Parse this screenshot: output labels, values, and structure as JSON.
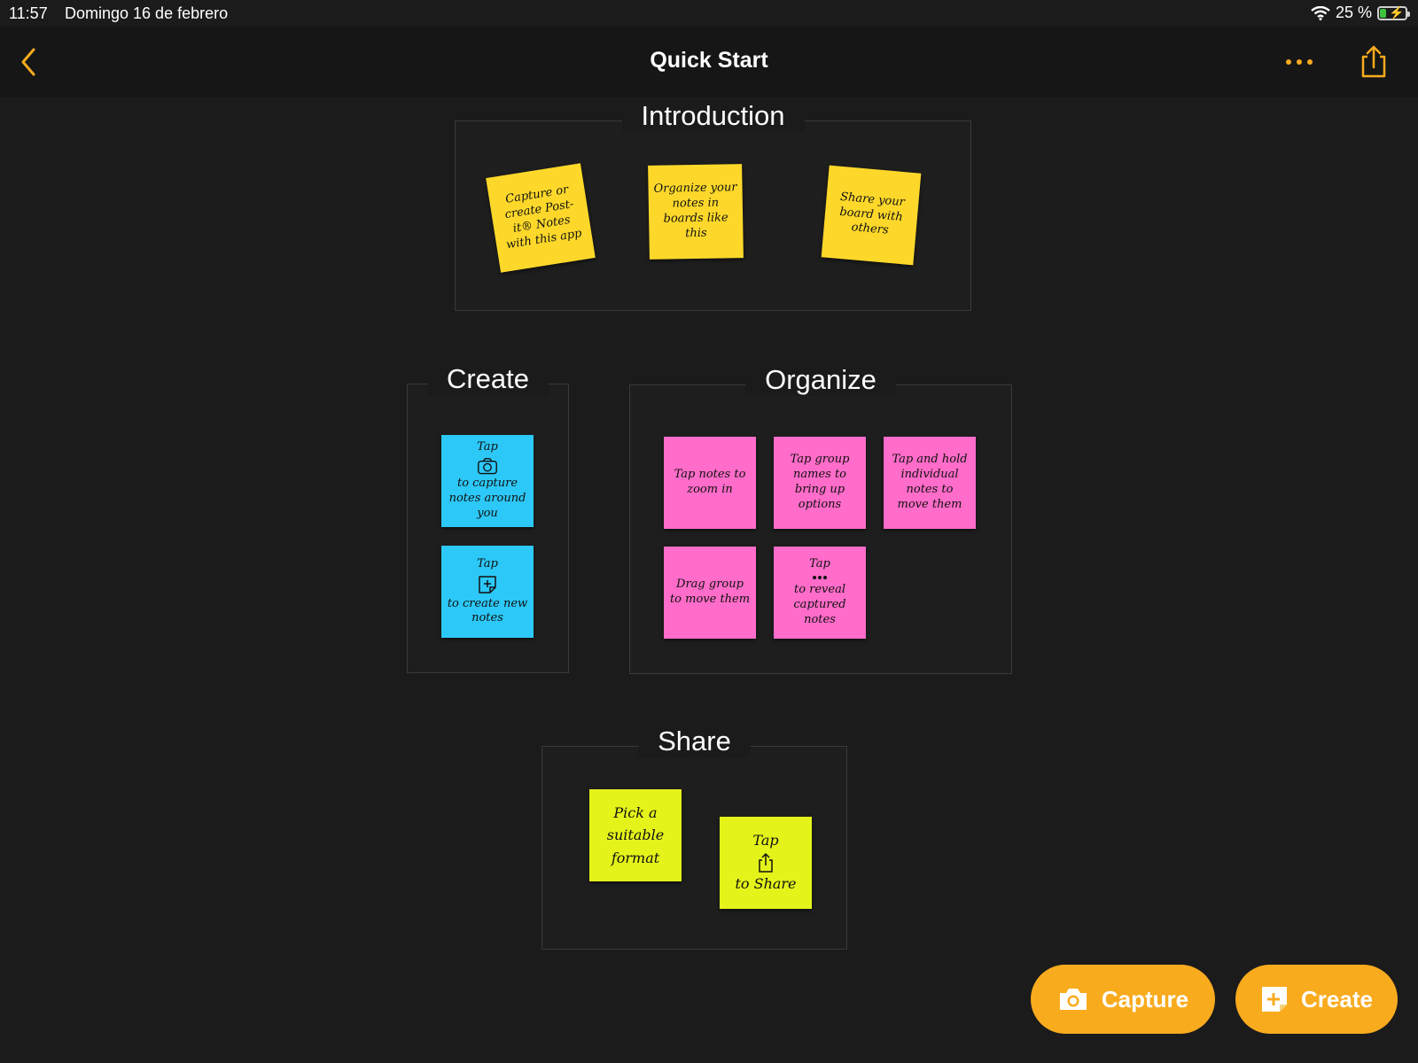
{
  "status_bar": {
    "time": "11:57",
    "date": "Domingo 16 de febrero",
    "battery": "25 %",
    "battery_level": 0.25
  },
  "nav": {
    "title": "Quick Start",
    "back_icon": "chevron-left-icon",
    "more_icon": "ellipsis-icon",
    "share_icon": "share-icon"
  },
  "groups": {
    "introduction": {
      "title": "Introduction",
      "notes": [
        "Capture or create Post-it® Notes with this app",
        "Organize your notes in boards like this",
        "Share your board with others"
      ]
    },
    "create": {
      "title": "Create",
      "notes": [
        {
          "before": "Tap",
          "icon": "camera-icon",
          "after": "to capture notes around you"
        },
        {
          "before": "Tap",
          "icon": "add-note-icon",
          "after": "to create new notes"
        }
      ]
    },
    "organize": {
      "title": "Organize",
      "notes": [
        "Tap notes to zoom in",
        "Tap group names to bring up options",
        "Tap and hold individual notes to move them",
        "Drag group to move them",
        {
          "before": "Tap",
          "icon": "ellipsis-icon",
          "after": "to reveal captured notes"
        }
      ]
    },
    "share": {
      "title": "Share",
      "notes": [
        "Pick a suitable format",
        {
          "before": "Tap",
          "icon": "share-icon",
          "after": "to Share"
        }
      ]
    }
  },
  "actions": {
    "capture_label": "Capture",
    "create_label": "Create"
  },
  "colors": {
    "accent": "#f9ab1e",
    "background": "#1b1b1b",
    "note_yellow": "#fdd82a",
    "note_blue": "#2cc8f7",
    "note_pink": "#ff6cc9",
    "note_lime": "#e4f31a"
  }
}
